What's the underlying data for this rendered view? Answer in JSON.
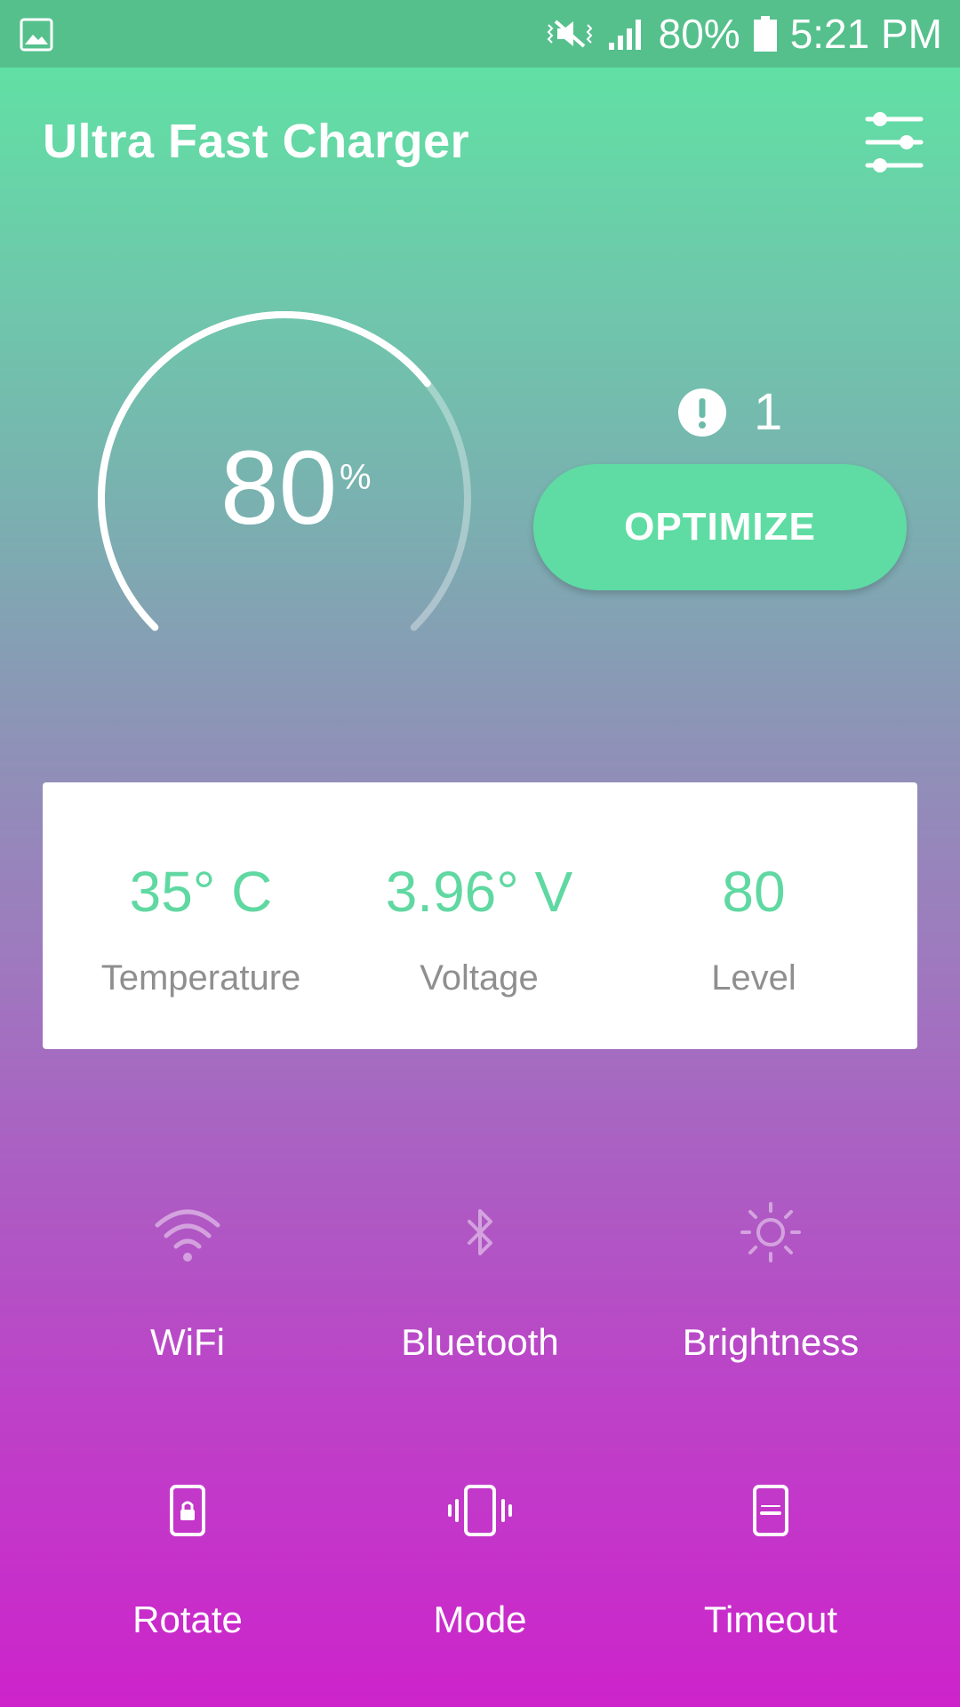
{
  "status_bar": {
    "battery_percent": "80%",
    "time": "5:21 PM",
    "icons": [
      "image-icon",
      "vibrate-mute-icon",
      "signal-icon",
      "battery-icon"
    ]
  },
  "header": {
    "title": "Ultra Fast Charger",
    "settings_icon": "sliders-icon"
  },
  "gauge": {
    "value": "80",
    "unit": "%",
    "level_fraction": 0.8
  },
  "issues": {
    "icon": "alert-icon",
    "count": "1"
  },
  "optimize": {
    "label": "OPTIMIZE"
  },
  "stats": [
    {
      "value": "35° C",
      "label": "Temperature"
    },
    {
      "value": "3.96° V",
      "label": "Voltage"
    },
    {
      "value": "80",
      "label": "Level"
    }
  ],
  "tools": [
    {
      "label": "WiFi",
      "icon": "wifi-icon"
    },
    {
      "label": "Bluetooth",
      "icon": "bluetooth-icon"
    },
    {
      "label": "Brightness",
      "icon": "brightness-icon"
    },
    {
      "label": "Rotate",
      "icon": "rotate-lock-icon"
    },
    {
      "label": "Mode",
      "icon": "vibrate-mode-icon"
    },
    {
      "label": "Timeout",
      "icon": "timeout-icon"
    }
  ],
  "colors": {
    "accent_green": "#5fdca3",
    "gradient_top": "#5de7a2",
    "gradient_bottom": "#cd23cb",
    "stat_label": "#8f8f8f"
  }
}
